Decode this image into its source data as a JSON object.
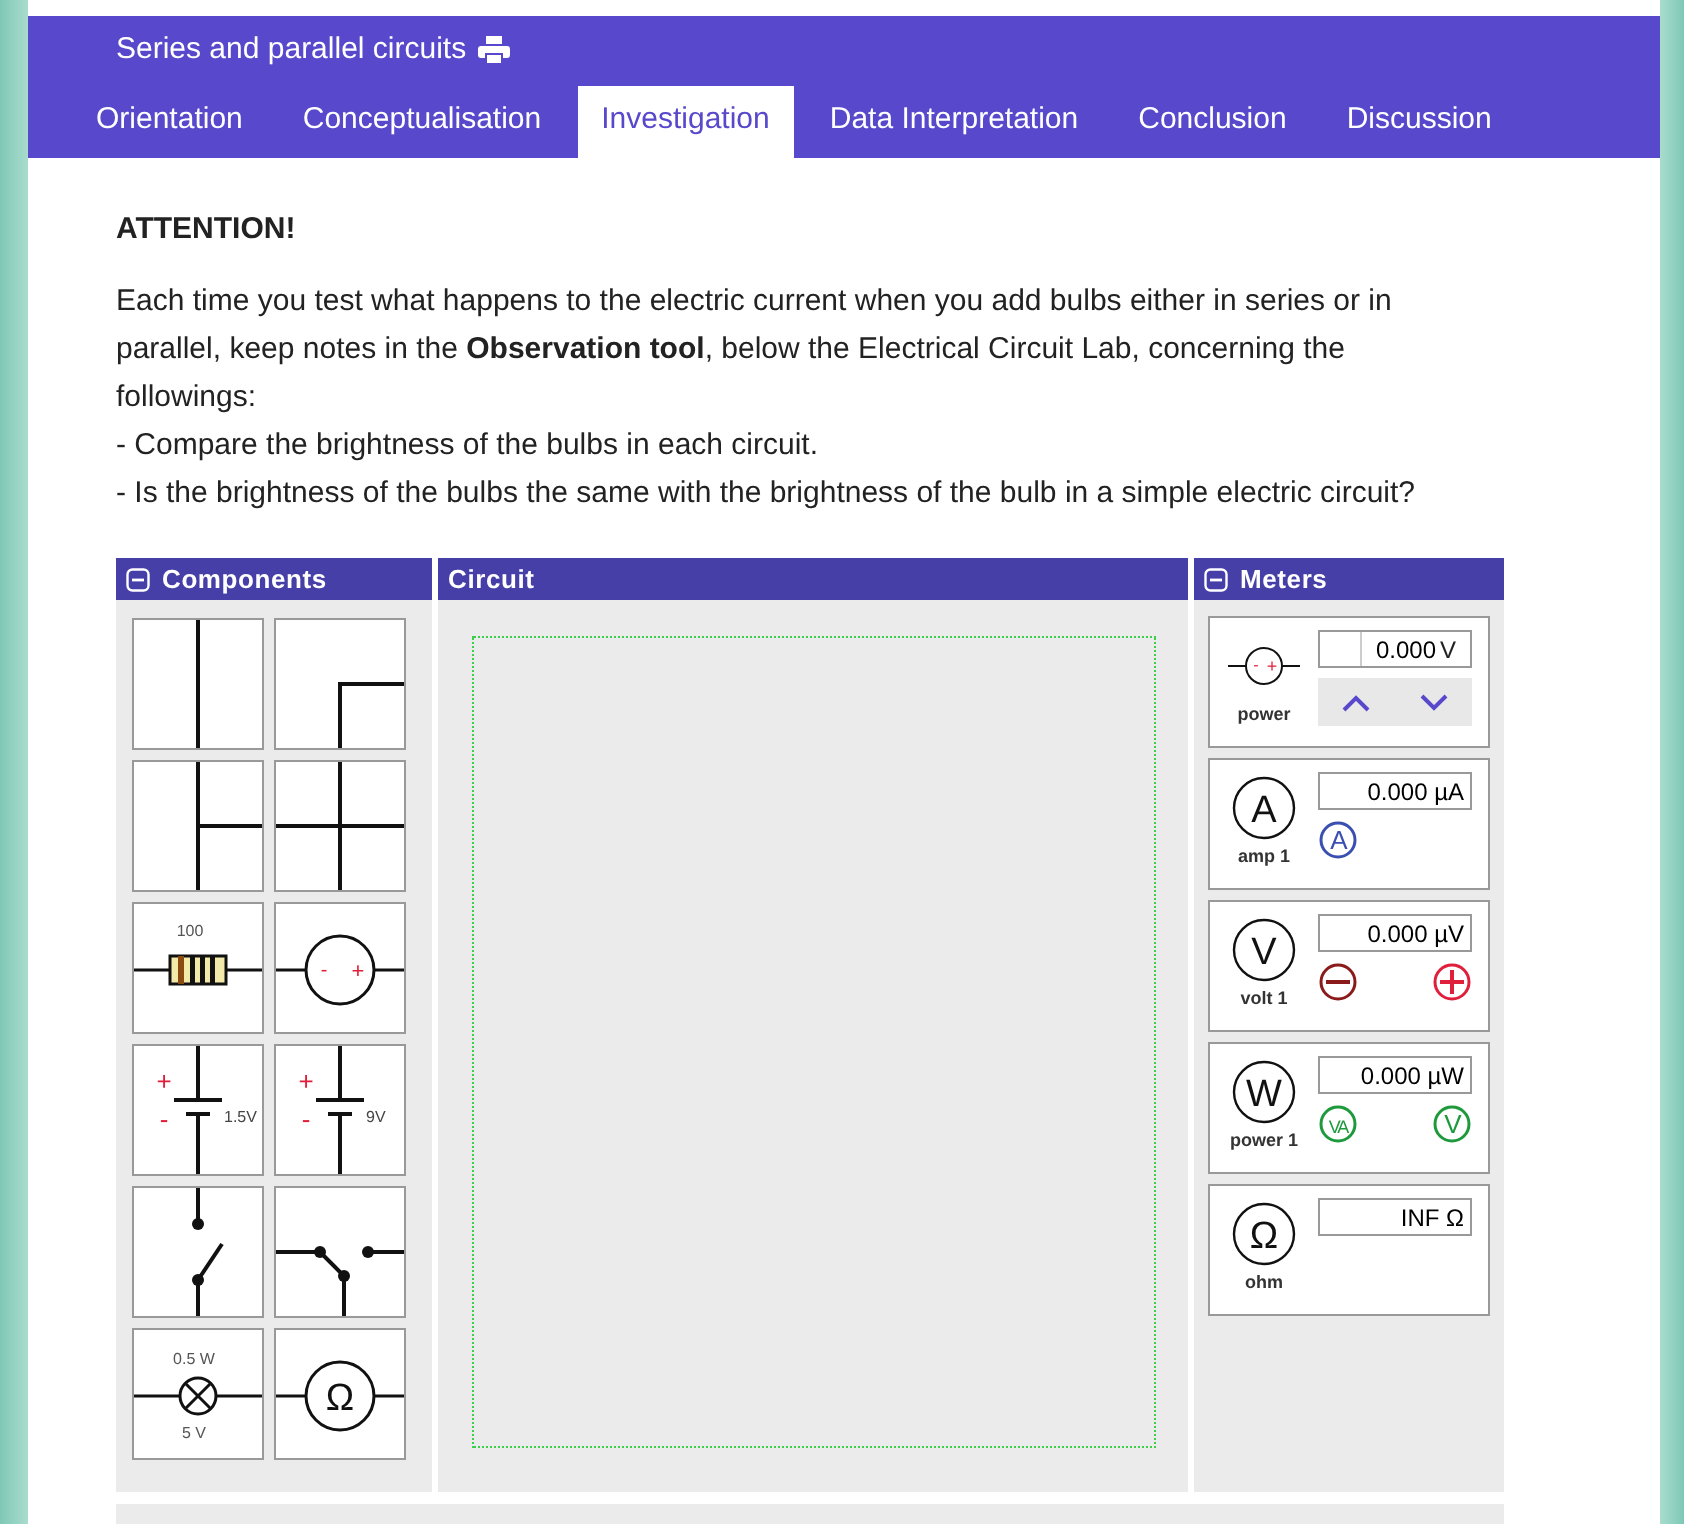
{
  "header": {
    "title": "Series and parallel circuits"
  },
  "tabs": [
    {
      "label": "Orientation",
      "selected": false
    },
    {
      "label": "Conceptualisation",
      "selected": false
    },
    {
      "label": "Investigation",
      "selected": true
    },
    {
      "label": "Data Interpretation",
      "selected": false
    },
    {
      "label": "Conclusion",
      "selected": false
    },
    {
      "label": "Discussion",
      "selected": false
    }
  ],
  "attention": {
    "heading": "ATTENTION!",
    "paragraph": "Each time you test what happens to the electric current when you add bulbs either in series or in parallel, keep notes in the **Observation tool**, below the Electrical Circuit Lab, concerning the followings:",
    "points": [
      "- Compare the brightness of the bulbs in each circuit.",
      "- Is the brightness of the bulbs the same with the brightness of the bulb in a simple electric circuit?"
    ]
  },
  "components_panel": {
    "title": "Components",
    "items": [
      {
        "kind": "wire-straight"
      },
      {
        "kind": "wire-corner"
      },
      {
        "kind": "wire-tee"
      },
      {
        "kind": "wire-cross"
      },
      {
        "kind": "resistor",
        "label": "100"
      },
      {
        "kind": "source",
        "minus": "-",
        "plus": "+"
      },
      {
        "kind": "battery",
        "plus": "+",
        "minus": "-",
        "label": "1.5V"
      },
      {
        "kind": "battery",
        "plus": "+",
        "minus": "-",
        "label": "9V"
      },
      {
        "kind": "switch"
      },
      {
        "kind": "switch-two-way"
      },
      {
        "kind": "bulb",
        "label": "0.5 W",
        "label_2": "5 V"
      },
      {
        "kind": "ohm",
        "symbol": "Ω"
      }
    ]
  },
  "circuit_panel": {
    "title": "Circuit"
  },
  "meters_panel": {
    "title": "Meters",
    "meters": [
      {
        "kind": "power",
        "minus": "-",
        "plus": "+",
        "label": "power",
        "reading": "0.000",
        "unit": "V"
      },
      {
        "kind": "amp",
        "symbol": "A",
        "label": "amp 1",
        "reading": "0.000 µA",
        "probes": [
          {
            "text": "A",
            "color": "#3a4fb0"
          }
        ]
      },
      {
        "kind": "volt",
        "symbol": "V",
        "label": "volt 1",
        "reading": "0.000 µV",
        "probes": [
          {
            "kind": "minus",
            "color": "#8b1a1a"
          },
          {
            "kind": "plus",
            "color": "#e0203a"
          }
        ]
      },
      {
        "kind": "watt",
        "symbol": "W",
        "label": "power 1",
        "reading": "0.000 µW",
        "probes": [
          {
            "text": "VA",
            "color": "#1e9a3c"
          },
          {
            "text": "V",
            "color": "#1e9a3c"
          }
        ]
      },
      {
        "kind": "ohm",
        "symbol": "Ω",
        "label": "ohm",
        "reading": "INF Ω"
      }
    ]
  }
}
